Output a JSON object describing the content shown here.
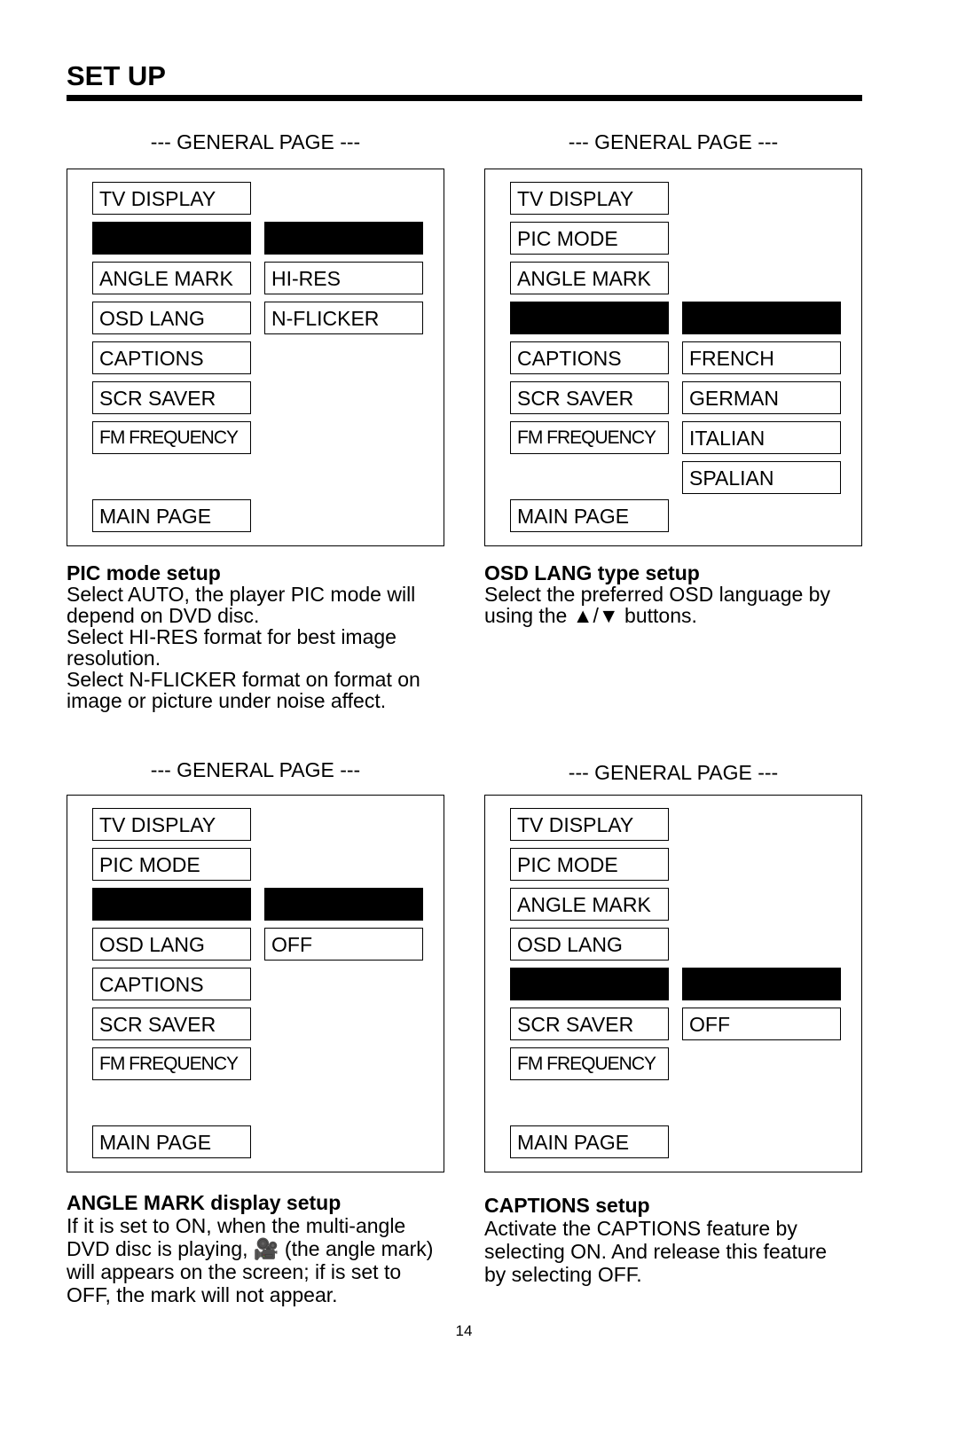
{
  "header": {
    "title": "SET UP"
  },
  "panels": [
    {
      "title": "--- GENERAL PAGE ---",
      "items": [
        "TV DISPLAY",
        "",
        "ANGLE MARK",
        "OSD LANG",
        "CAPTIONS",
        "SCR SAVER",
        "FM FREQUENCY"
      ],
      "selected_row": 1,
      "options": [
        "",
        "HI-RES",
        "N-FLICKER"
      ],
      "option_start_row": 1,
      "main": "MAIN PAGE",
      "heading": "PIC mode setup",
      "lines": [
        "Select AUTO, the player PIC mode will",
        "depend on DVD disc.",
        "Select HI-RES format for best image",
        "resolution.",
        "Select N-FLICKER format on format on",
        "image or picture under noise affect."
      ]
    },
    {
      "title": "--- GENERAL PAGE ---",
      "items": [
        "TV DISPLAY",
        "PIC MODE",
        "ANGLE MARK",
        "",
        "CAPTIONS",
        "SCR SAVER",
        "FM FREQUENCY"
      ],
      "selected_row": 3,
      "options": [
        "",
        "FRENCH",
        "GERMAN",
        "ITALIAN",
        "SPALIAN"
      ],
      "option_start_row": 3,
      "main": "MAIN PAGE",
      "heading": "OSD LANG type setup",
      "lines": [
        "Select the preferred OSD language by",
        "using the ▲/▼ buttons."
      ]
    },
    {
      "title": "--- GENERAL PAGE ---",
      "items": [
        "TV DISPLAY",
        "PIC MODE",
        "",
        "OSD LANG",
        "CAPTIONS",
        "SCR SAVER",
        "FM FREQUENCY"
      ],
      "selected_row": 2,
      "options": [
        "",
        "OFF"
      ],
      "option_start_row": 2,
      "main": "MAIN PAGE",
      "heading": "ANGLE MARK display setup",
      "lines": [
        "If it is set to ON, when the multi-angle",
        "DVD disc is playing, 🎥 (the angle mark)",
        "will appears on the screen; if is set to",
        "OFF, the mark will not appear."
      ]
    },
    {
      "title": "--- GENERAL PAGE ---",
      "items": [
        "TV DISPLAY",
        "PIC MODE",
        "ANGLE MARK",
        "OSD LANG",
        "",
        "SCR SAVER",
        "FM FREQUENCY"
      ],
      "selected_row": 4,
      "options": [
        "",
        "OFF"
      ],
      "option_start_row": 4,
      "main": "MAIN PAGE",
      "heading": "CAPTIONS setup",
      "lines": [
        "Activate the CAPTIONS feature by",
        "selecting ON.  And release this feature",
        "by selecting OFF."
      ]
    }
  ],
  "page_number": "14"
}
